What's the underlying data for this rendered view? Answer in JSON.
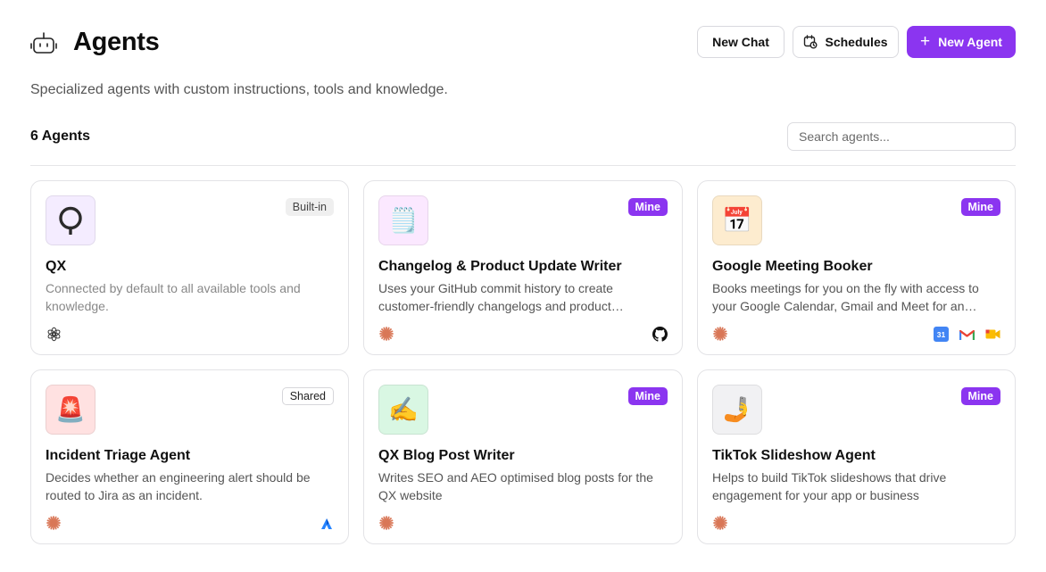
{
  "header": {
    "title": "Agents",
    "robot_icon": "robot-icon",
    "new_chat": "New Chat",
    "schedules": "Schedules",
    "new_agent": "New Agent",
    "plus_glyph": "+"
  },
  "subtitle": "Specialized agents with custom instructions, tools and knowledge.",
  "count": "6 Agents",
  "search": {
    "placeholder": "Search agents...",
    "value": ""
  },
  "colors": {
    "accent": "#8b35f0"
  },
  "agents": [
    {
      "name": "QX",
      "badge": "Built-in",
      "description": "Connected by default to all available tools and knowledge.",
      "emoji": "",
      "avatar_bg": "#f4ecff",
      "footer_icon": "openai-icon",
      "tools": []
    },
    {
      "name": "Changelog & Product Update Writer",
      "badge": "Mine",
      "description": "Uses your GitHub commit history to create customer-friendly changelogs and product updates.",
      "emoji": "🗒️",
      "avatar_bg": "#fbe8ff",
      "footer_icon": "anthropic-icon",
      "tools": [
        "github-icon"
      ]
    },
    {
      "name": "Google Meeting Booker",
      "badge": "Mine",
      "description": "Books meetings for you on the fly with access to your Google Calendar, Gmail and Meet for an effortless experience.",
      "emoji": "📅",
      "avatar_bg": "#fdeccf",
      "footer_icon": "anthropic-icon",
      "tools": [
        "google-calendar-icon",
        "gmail-icon",
        "google-meet-icon"
      ],
      "calendar_day": "31"
    },
    {
      "name": "Incident Triage Agent",
      "badge": "Shared",
      "description": "Decides whether an engineering alert should be routed to Jira as an incident.",
      "emoji": "🚨",
      "avatar_bg": "#ffe1e1",
      "footer_icon": "anthropic-icon",
      "tools": [
        "jira-icon"
      ]
    },
    {
      "name": "QX Blog Post Writer",
      "badge": "Mine",
      "description": "Writes SEO and AEO optimised blog posts for the QX website",
      "emoji": "✍️",
      "avatar_bg": "#d9f7e3",
      "footer_icon": "anthropic-icon",
      "tools": []
    },
    {
      "name": "TikTok Slideshow Agent",
      "badge": "Mine",
      "description": "Helps to build TikTok slideshows that drive engagement for your app or business",
      "emoji": "🤳",
      "avatar_bg": "#f1f1f3",
      "footer_icon": "anthropic-icon",
      "tools": []
    }
  ]
}
